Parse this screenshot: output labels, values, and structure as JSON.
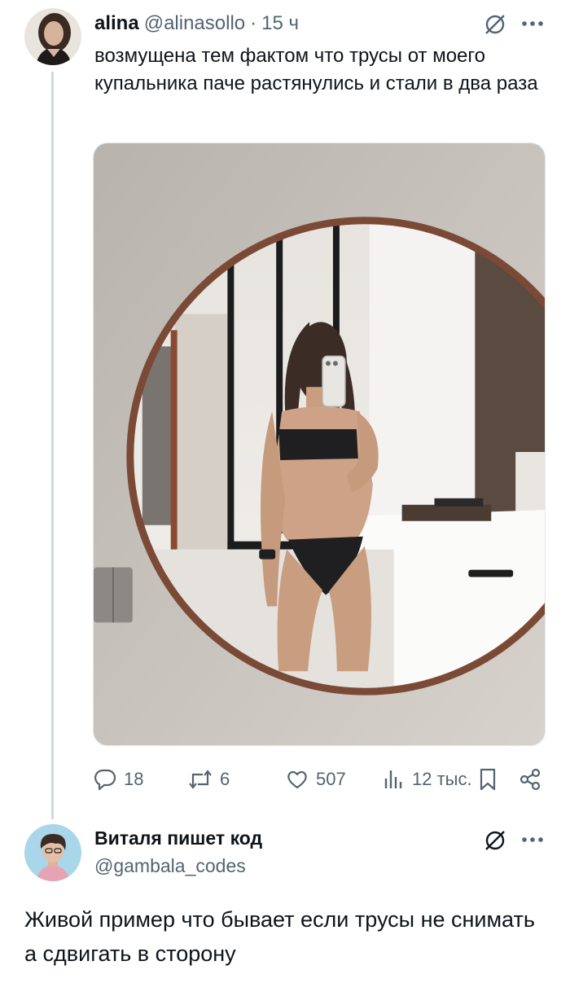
{
  "tweet": {
    "author_name": "alina",
    "author_handle": "@alinasollo",
    "separator": "·",
    "time": "15 ч",
    "text": "возмущена тем фактом что трусы от моего купальника паче растянулись и стали в два раза",
    "stats": {
      "replies": "18",
      "retweets": "6",
      "likes": "507",
      "views": "12 тыс."
    }
  },
  "reply": {
    "author_name": "Виталя пишет код",
    "author_handle": "@gambala_codes",
    "text": "Живой пример что бывает если трусы не снимать а сдвигать в сторону"
  },
  "icons": {
    "grok": "grok-icon",
    "more": "more-icon",
    "reply": "reply-icon",
    "retweet": "retweet-icon",
    "like": "heart-icon",
    "views": "views-icon",
    "bookmark": "bookmark-icon",
    "share": "share-icon"
  },
  "colors": {
    "text": "#0f1419",
    "secondary": "#536471",
    "thread_line": "#cfd9de"
  }
}
